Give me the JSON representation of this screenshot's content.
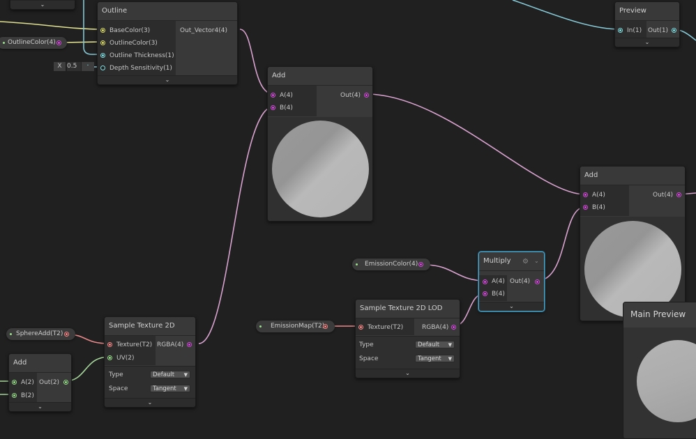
{
  "colors": {
    "vector4": "#d94de0",
    "vector3": "#e3e36c",
    "vector1": "#84e4e7",
    "vector2": "#9be28d",
    "texture": "#ff8b8b",
    "wire_vec4": "#d9a3cf",
    "wire_vec3": "#e1e192",
    "wire_vec1": "#85c7d4",
    "wire_vec2": "#a6d69b",
    "wire_tex": "#e98989"
  },
  "outline": {
    "title": "Outline",
    "in_base": "BaseColor(3)",
    "in_outline_color": "OutlineColor(3)",
    "in_thickness": "Outline Thickness(1)",
    "in_depth": "Depth Sensitivity(1)",
    "out": "Out_Vector4(4)",
    "expand": "⌄"
  },
  "outline_color_prop": {
    "label": "OutlineColor(4)"
  },
  "depth_field": {
    "axis": "X",
    "value": "0.5"
  },
  "preview_node": {
    "title": "Preview",
    "in": "In(1)",
    "out": "Out(1)",
    "expand": "⌄"
  },
  "add_top": {
    "title": "Add",
    "in_a": "A(4)",
    "in_b": "B(4)",
    "out": "Out(4)"
  },
  "add_right": {
    "title": "Add",
    "in_a": "A(4)",
    "in_b": "B(4)",
    "out": "Out(4)"
  },
  "emission_color_prop": {
    "label": "EmissionColor(4)"
  },
  "multiply": {
    "title": "Multiply",
    "in_a": "A(4)",
    "in_b": "B(4)",
    "out": "Out(4)",
    "expand": "⌄",
    "gear": "⚙",
    "chev": "⌄"
  },
  "emission_map_prop": {
    "label": "EmissionMap(T2)"
  },
  "sample_lod": {
    "title": "Sample Texture 2D LOD",
    "in_tex": "Texture(T2)",
    "out": "RGBA(4)",
    "type_label": "Type",
    "type_value": "Default",
    "space_label": "Space",
    "space_value": "Tangent",
    "expand": "⌄"
  },
  "sphere_add_prop": {
    "label": "SphereAdd(T2)"
  },
  "sample_tex": {
    "title": "Sample Texture 2D",
    "in_tex": "Texture(T2)",
    "in_uv": "UV(2)",
    "out": "RGBA(4)",
    "type_label": "Type",
    "type_value": "Default",
    "space_label": "Space",
    "space_value": "Tangent",
    "expand": "⌄"
  },
  "add_small": {
    "title": "Add",
    "in_a": "A(2)",
    "in_b": "B(2)",
    "out": "Out(2)",
    "expand": "⌄"
  },
  "main_preview": {
    "title": "Main Preview"
  },
  "top_node": {
    "expand": "⌄"
  }
}
